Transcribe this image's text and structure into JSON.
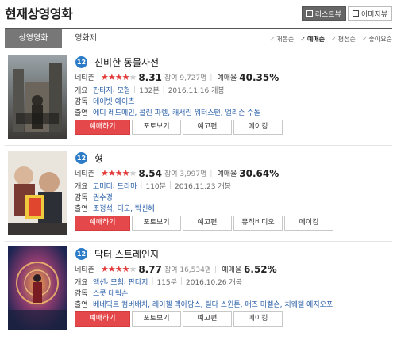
{
  "header": {
    "title": "현재상영영화",
    "list_view": "리스트뷰",
    "image_view": "이미지뷰"
  },
  "tabs": [
    {
      "label": "상영영화"
    },
    {
      "label": "영화제"
    }
  ],
  "sorts": [
    {
      "label": "개봉순"
    },
    {
      "label": "예매순"
    },
    {
      "label": "평점순"
    },
    {
      "label": "좋아요순"
    }
  ],
  "labels": {
    "netizen": "네티즌",
    "reservation": "예매율",
    "overview": "개요",
    "director": "감독",
    "cast": "출연"
  },
  "movies": [
    {
      "age": "12",
      "title": "신비한 동물사전",
      "score": "8.31",
      "votes": "참여 9,727명",
      "reservation": "40.35%",
      "genres": [
        "판타지",
        "모험"
      ],
      "runtime": "132분",
      "release": "2016.11.16 개봉",
      "director": "데이빗 예이츠",
      "cast": "에디 레드메인, 콜린 파렐, 캐서린 워터스턴, 앨리슨 수돌",
      "buttons": [
        "예매하기",
        "포토보기",
        "예고편",
        "메이킹"
      ]
    },
    {
      "age": "12",
      "title": "형",
      "score": "8.54",
      "votes": "참여 3,997명",
      "reservation": "30.64%",
      "genres": [
        "코미디",
        "드라마"
      ],
      "runtime": "110분",
      "release": "2016.11.23 개봉",
      "director": "권수경",
      "cast": "조정석, 디오, 박신혜",
      "buttons": [
        "예매하기",
        "포토보기",
        "예고편",
        "뮤직비디오",
        "메이킹"
      ]
    },
    {
      "age": "12",
      "title": "닥터 스트레인지",
      "score": "8.77",
      "votes": "참여 16,534명",
      "reservation": "6.52%",
      "genres": [
        "액션",
        "모험",
        "판타지"
      ],
      "runtime": "115분",
      "release": "2016.10.26 개봉",
      "director": "스콧 데릭슨",
      "cast": "베네딕트 컴버배치, 레이첼 맥아담스, 틸다 스윈튼, 매즈 미켈슨, 치웨텔 에지오포",
      "buttons": [
        "예매하기",
        "포토보기",
        "예고편",
        "메이킹"
      ]
    }
  ],
  "colors": {
    "accent_red": "#e5484a",
    "age_badge": "#2c7bc6",
    "link": "#2a5fa8"
  }
}
